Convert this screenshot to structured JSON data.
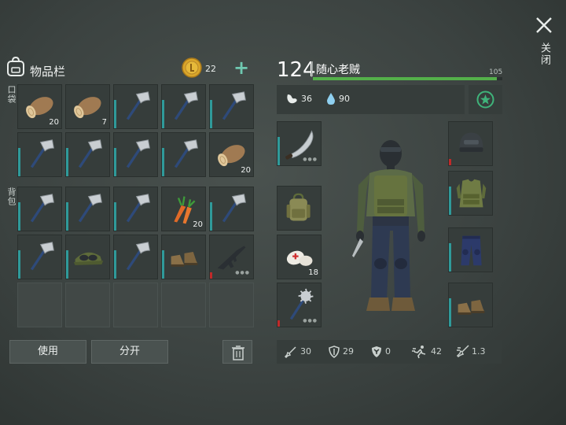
{
  "header": {
    "title": "物品栏",
    "coins": "22"
  },
  "sections": {
    "pocket": "口袋",
    "backpack": "背包"
  },
  "inventory": [
    {
      "item": "log-icon",
      "count": "20",
      "bar": "none"
    },
    {
      "item": "log-icon",
      "count": "7",
      "bar": "none"
    },
    {
      "item": "hatchet-icon",
      "count": "",
      "bar": "teal"
    },
    {
      "item": "hatchet-icon",
      "count": "",
      "bar": "teal"
    },
    {
      "item": "hatchet-icon",
      "count": "",
      "bar": "teal"
    },
    {
      "item": "hatchet-icon",
      "count": "",
      "bar": "teal"
    },
    {
      "item": "hatchet-icon",
      "count": "",
      "bar": "teal"
    },
    {
      "item": "hatchet-icon",
      "count": "",
      "bar": "teal"
    },
    {
      "item": "hatchet-icon",
      "count": "",
      "bar": "teal"
    },
    {
      "item": "log-icon",
      "count": "20",
      "bar": "none"
    },
    {
      "item": "hatchet-icon",
      "count": "",
      "bar": "teal"
    },
    {
      "item": "hatchet-icon",
      "count": "",
      "bar": "teal"
    },
    {
      "item": "hatchet-icon",
      "count": "",
      "bar": "teal"
    },
    {
      "item": "carrot-icon",
      "count": "20",
      "bar": "none"
    },
    {
      "item": "hatchet-icon",
      "count": "",
      "bar": "teal"
    },
    {
      "item": "hatchet-icon",
      "count": "",
      "bar": "teal"
    },
    {
      "item": "cap-goggles-icon",
      "count": "",
      "bar": "teal"
    },
    {
      "item": "hatchet-icon",
      "count": "",
      "bar": "teal"
    },
    {
      "item": "boots-icon",
      "count": "",
      "bar": "teal"
    },
    {
      "item": "rifle-icon",
      "count": "",
      "bar": "red"
    },
    {
      "item": "",
      "count": "",
      "bar": "none"
    },
    {
      "item": "",
      "count": "",
      "bar": "none"
    },
    {
      "item": "",
      "count": "",
      "bar": "none"
    },
    {
      "item": "",
      "count": "",
      "bar": "none"
    },
    {
      "item": "",
      "count": "",
      "bar": "none"
    }
  ],
  "buttons": {
    "use": "使用",
    "split": "分开"
  },
  "player": {
    "level": "124",
    "name": "随心老贼",
    "xp_max": "105",
    "xp_fraction": 0.97
  },
  "status": {
    "hunger": "36",
    "thirst": "90"
  },
  "equipment": {
    "left": [
      {
        "item": "machete-icon",
        "count": "",
        "bar": "teal"
      },
      {
        "item": "backpack-icon",
        "count": "",
        "bar": "none"
      },
      {
        "item": "bandage-icon",
        "count": "18",
        "bar": "none"
      },
      {
        "item": "spiked-mace-icon",
        "count": "",
        "bar": "red"
      }
    ],
    "right": [
      {
        "item": "helmet-icon",
        "count": "",
        "bar": "red"
      },
      {
        "item": "vest-icon",
        "count": "",
        "bar": "teal"
      },
      {
        "item": "pants-icon",
        "count": "",
        "bar": "teal"
      },
      {
        "item": "boots-icon",
        "count": "",
        "bar": "teal"
      }
    ]
  },
  "stats": {
    "damage": "30",
    "defense": "29",
    "radiation": "0",
    "speed": "42",
    "attack_speed": "1.3"
  },
  "close_label": "关闭",
  "colors": {
    "accent": "#6fc8b0",
    "xp_green": "#54b04a",
    "durability_teal": "#2f9a9a",
    "durability_red": "#c02a2a"
  }
}
